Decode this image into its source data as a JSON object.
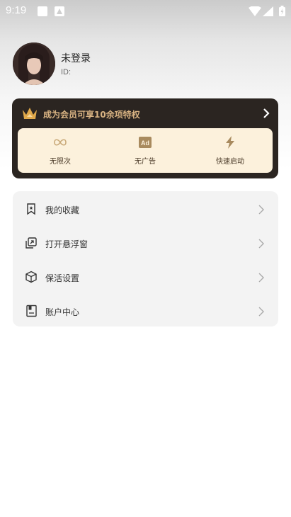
{
  "status": {
    "time": "9:19"
  },
  "profile": {
    "name": "未登录",
    "id_label": "ID:"
  },
  "vip": {
    "title": "成为会员可享10余项特权",
    "accent": "#d9b483",
    "perks": [
      {
        "icon": "infinity-icon",
        "label": "无限次"
      },
      {
        "icon": "ad-icon",
        "label": "无广告"
      },
      {
        "icon": "lightning-icon",
        "label": "快速启动"
      }
    ]
  },
  "menu": {
    "items": [
      {
        "icon": "bookmark-icon",
        "label": "我的收藏"
      },
      {
        "icon": "floating-window-icon",
        "label": "打开悬浮窗"
      },
      {
        "icon": "cube-icon",
        "label": "保活设置"
      },
      {
        "icon": "account-book-icon",
        "label": "账户中心"
      }
    ]
  }
}
